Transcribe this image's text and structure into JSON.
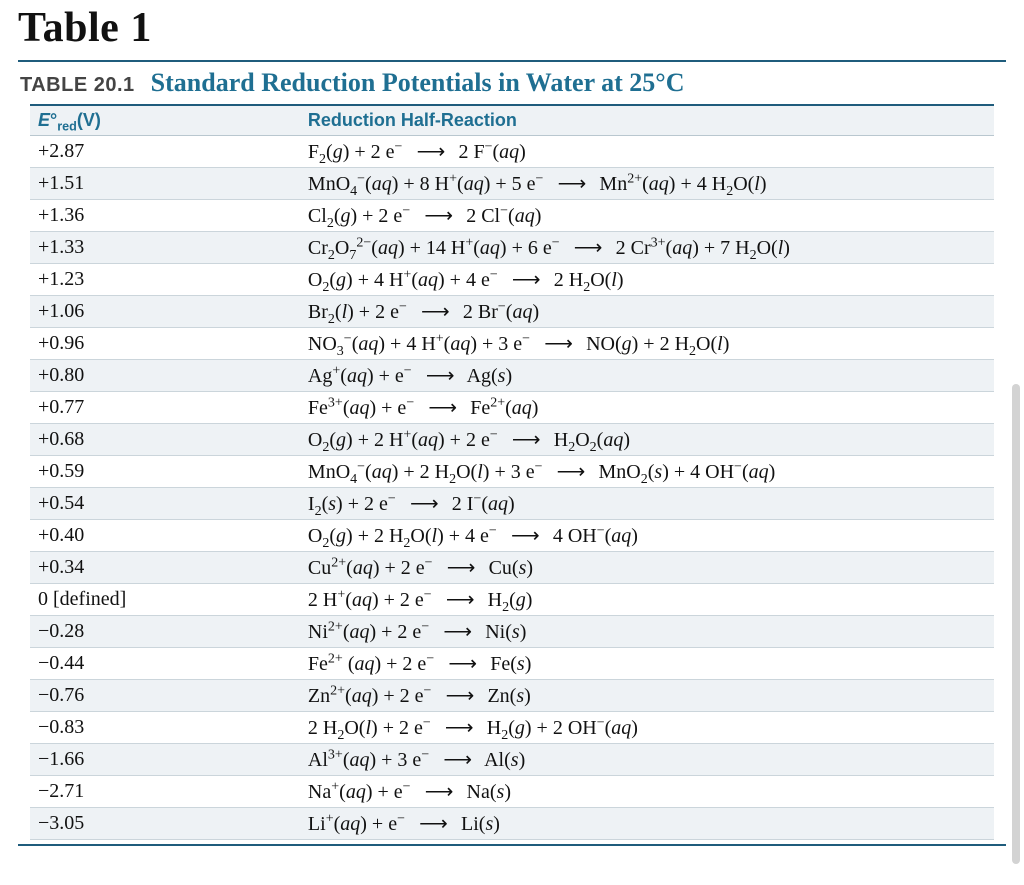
{
  "page_title": "Table 1",
  "table_number": "TABLE 20.1",
  "table_title": "Standard Reduction Potentials in Water at 25°C",
  "columns": {
    "potential_header_html": "<i>E</i>°<sub>red</sub>(V)",
    "reaction_header": "Reduction Half-Reaction"
  },
  "arrow": "⟶",
  "rows": [
    {
      "potential": "+2.87",
      "reaction_html": "F<sub>2</sub>(<i>g</i>) + 2 e<sup>−</sup> <span class='arrow'>⟶</span> 2 F<sup>−</sup>(<i>aq</i>)"
    },
    {
      "potential": "+1.51",
      "reaction_html": "MnO<sub>4</sub><sup>−</sup>(<i>aq</i>) + 8 H<sup>+</sup>(<i>aq</i>) + 5 e<sup>−</sup> <span class='arrow'>⟶</span> Mn<sup>2+</sup>(<i>aq</i>) + 4 H<sub>2</sub>O(<i>l</i>)"
    },
    {
      "potential": "+1.36",
      "reaction_html": "Cl<sub>2</sub>(<i>g</i>) + 2 e<sup>−</sup> <span class='arrow'>⟶</span> 2 Cl<sup>−</sup>(<i>aq</i>)"
    },
    {
      "potential": "+1.33",
      "reaction_html": "Cr<sub>2</sub>O<sub>7</sub><sup>2−</sup>(<i>aq</i>) + 14 H<sup>+</sup>(<i>aq</i>) + 6 e<sup>−</sup> <span class='arrow'>⟶</span> 2 Cr<sup>3+</sup>(<i>aq</i>) + 7 H<sub>2</sub>O(<i>l</i>)"
    },
    {
      "potential": "+1.23",
      "reaction_html": "O<sub>2</sub>(<i>g</i>) + 4 H<sup>+</sup>(<i>aq</i>) + 4 e<sup>−</sup> <span class='arrow'>⟶</span> 2 H<sub>2</sub>O(<i>l</i>)"
    },
    {
      "potential": "+1.06",
      "reaction_html": "Br<sub>2</sub>(<i>l</i>) + 2 e<sup>−</sup> <span class='arrow'>⟶</span> 2 Br<sup>−</sup>(<i>aq</i>)"
    },
    {
      "potential": "+0.96",
      "reaction_html": "NO<sub>3</sub><sup>−</sup>(<i>aq</i>) + 4 H<sup>+</sup>(<i>aq</i>) + 3 e<sup>−</sup> <span class='arrow'>⟶</span> NO(<i>g</i>) + 2 H<sub>2</sub>O(<i>l</i>)"
    },
    {
      "potential": "+0.80",
      "reaction_html": "Ag<sup>+</sup>(<i>aq</i>) + e<sup>−</sup> <span class='arrow'>⟶</span> Ag(<i>s</i>)"
    },
    {
      "potential": "+0.77",
      "reaction_html": "Fe<sup>3+</sup>(<i>aq</i>) + e<sup>−</sup> <span class='arrow'>⟶</span> Fe<sup>2+</sup>(<i>aq</i>)"
    },
    {
      "potential": "+0.68",
      "reaction_html": "O<sub>2</sub>(<i>g</i>) + 2 H<sup>+</sup>(<i>aq</i>) + 2 e<sup>−</sup> <span class='arrow'>⟶</span> H<sub>2</sub>O<sub>2</sub>(<i>aq</i>)"
    },
    {
      "potential": "+0.59",
      "reaction_html": "MnO<sub>4</sub><sup>−</sup>(<i>aq</i>) + 2 H<sub>2</sub>O(<i>l</i>) + 3 e<sup>−</sup> <span class='arrow'>⟶</span> MnO<sub>2</sub>(<i>s</i>) + 4 OH<sup>−</sup>(<i>aq</i>)"
    },
    {
      "potential": "+0.54",
      "reaction_html": "I<sub>2</sub>(<i>s</i>) + 2 e<sup>−</sup> <span class='arrow'>⟶</span> 2 I<sup>−</sup>(<i>aq</i>)"
    },
    {
      "potential": "+0.40",
      "reaction_html": "O<sub>2</sub>(<i>g</i>) + 2 H<sub>2</sub>O(<i>l</i>) + 4 e<sup>−</sup> <span class='arrow'>⟶</span> 4 OH<sup>−</sup>(<i>aq</i>)"
    },
    {
      "potential": "+0.34",
      "reaction_html": "Cu<sup>2+</sup>(<i>aq</i>) + 2 e<sup>−</sup> <span class='arrow'>⟶</span> Cu(<i>s</i>)"
    },
    {
      "potential": "0 [defined]",
      "reaction_html": "2 H<sup>+</sup>(<i>aq</i>) + 2 e<sup>−</sup> <span class='arrow'>⟶</span> H<sub>2</sub>(<i>g</i>)"
    },
    {
      "potential": "−0.28",
      "reaction_html": "Ni<sup>2+</sup>(<i>aq</i>) + 2 e<sup>−</sup> <span class='arrow'>⟶</span> Ni(<i>s</i>)"
    },
    {
      "potential": "−0.44",
      "reaction_html": "Fe<sup>2+</sup> (<i>aq</i>) + 2 e<sup>−</sup> <span class='arrow'>⟶</span> Fe(<i>s</i>)"
    },
    {
      "potential": "−0.76",
      "reaction_html": "Zn<sup>2+</sup>(<i>aq</i>) + 2 e<sup>−</sup> <span class='arrow'>⟶</span> Zn(<i>s</i>)"
    },
    {
      "potential": "−0.83",
      "reaction_html": "2 H<sub>2</sub>O(<i>l</i>) + 2 e<sup>−</sup> <span class='arrow'>⟶</span> H<sub>2</sub>(<i>g</i>) + 2 OH<sup>−</sup>(<i>aq</i>)"
    },
    {
      "potential": "−1.66",
      "reaction_html": "Al<sup>3+</sup>(<i>aq</i>) + 3 e<sup>−</sup> <span class='arrow'>⟶</span> Al(<i>s</i>)"
    },
    {
      "potential": "−2.71",
      "reaction_html": "Na<sup>+</sup>(<i>aq</i>) + e<sup>−</sup> <span class='arrow'>⟶</span> Na(<i>s</i>)"
    },
    {
      "potential": "−3.05",
      "reaction_html": "Li<sup>+</sup>(<i>aq</i>) + e<sup>−</sup> <span class='arrow'>⟶</span> Li(<i>s</i>)"
    }
  ]
}
